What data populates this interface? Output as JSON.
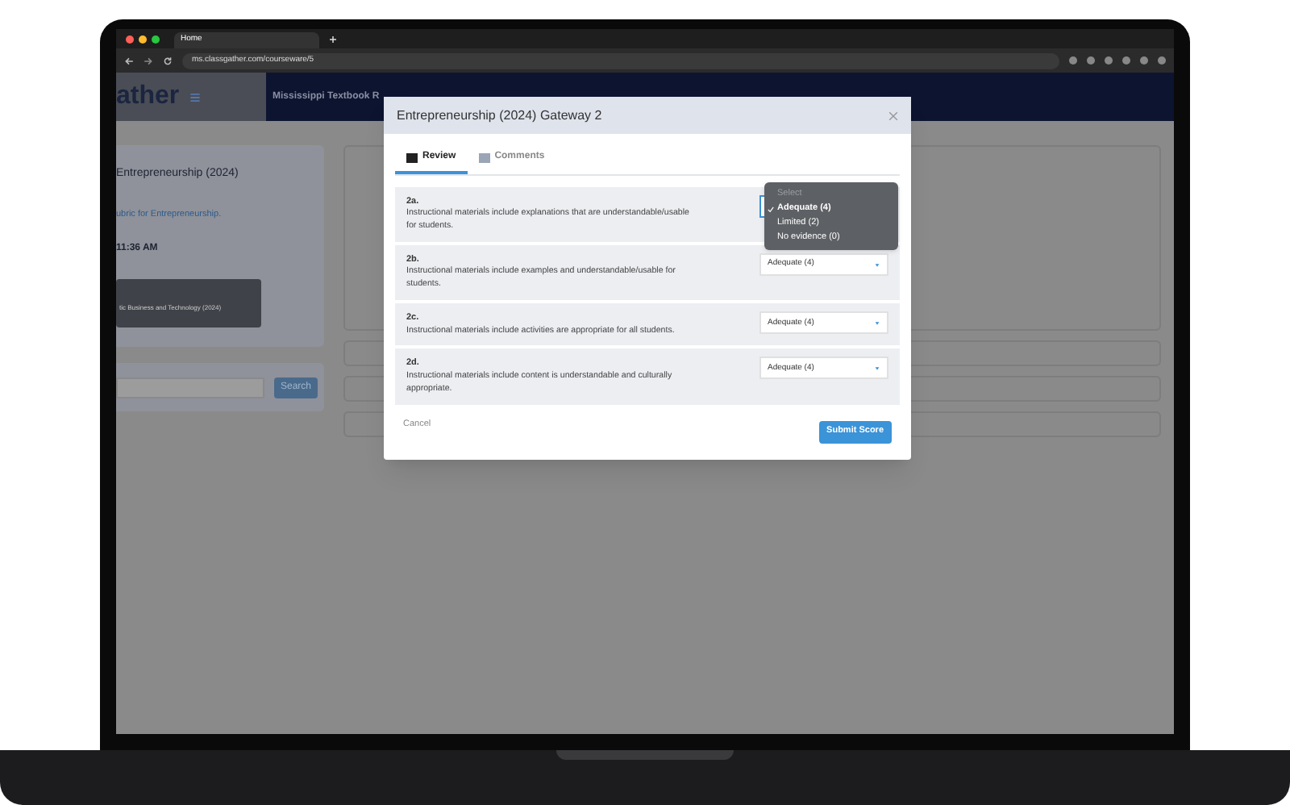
{
  "browser": {
    "tab_title": "Home",
    "url": "ms.classgather.com/courseware/5"
  },
  "app_header": {
    "logo": "ather",
    "title": "Mississippi Textbook R"
  },
  "background": {
    "course_title": "Entrepreneurship (2024)",
    "link": "ubric for Entrepreneurship.",
    "time": "11:36 AM",
    "tooltip": "tic Business and Technology (2024)",
    "search_button": "Search"
  },
  "modal": {
    "title": "Entrepreneurship (2024) Gateway 2",
    "tabs": [
      {
        "label": "Review",
        "selected": true
      },
      {
        "label": "Comments",
        "selected": false
      }
    ],
    "criteria": [
      {
        "code": "2a.",
        "text": "Instructional materials include explanations that are understandable/usable for students.",
        "open": true,
        "options": [
          {
            "label": "Select",
            "kind": "placeholder",
            "selected": false
          },
          {
            "label": "Adequate (4)",
            "kind": "option",
            "selected": true
          },
          {
            "label": "Limited (2)",
            "kind": "option",
            "selected": false
          },
          {
            "label": "No evidence (0)",
            "kind": "option",
            "selected": false
          }
        ]
      },
      {
        "code": "2b.",
        "text": "Instructional materials include examples and understandable/usable for students.",
        "open": false,
        "value": "Adequate (4)"
      },
      {
        "code": "2c.",
        "text": "Instructional materials include activities are appropriate for all students.",
        "open": false,
        "value": "Adequate (4)"
      },
      {
        "code": "2d.",
        "text": "Instructional materials include content is understandable and culturally appropriate.",
        "open": false,
        "value": "Adequate (4)"
      }
    ],
    "cancel": "Cancel",
    "submit": "Submit Score"
  }
}
